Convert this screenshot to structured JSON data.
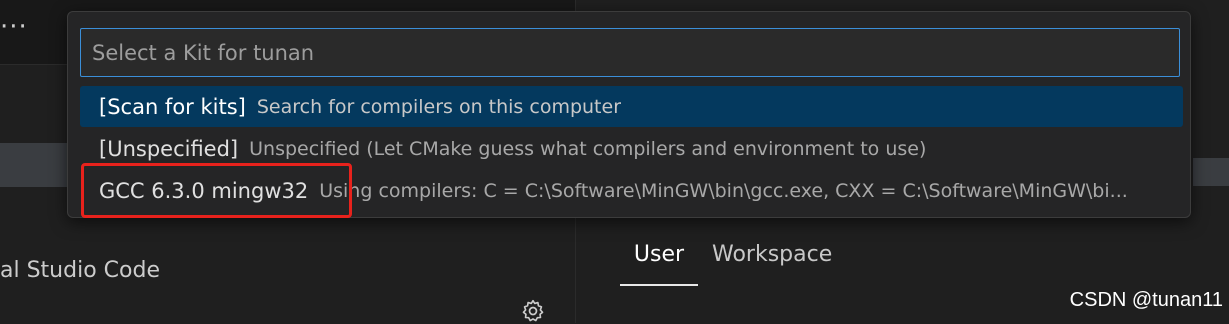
{
  "quick_pick": {
    "placeholder": "Select a Kit for tunan",
    "input_value": "",
    "items": [
      {
        "label": "[Scan for kits]",
        "description": "Search for compilers on this computer",
        "selected": true
      },
      {
        "label": "[Unspecified]",
        "description": "Unspecified (Let CMake guess what compilers and environment to use)",
        "selected": false
      },
      {
        "label": "GCC 6.3.0 mingw32",
        "description": "Using compilers: C = C:\\Software\\MinGW\\bin\\gcc.exe, CXX = C:\\Software\\MinGW\\bi...",
        "selected": false
      }
    ]
  },
  "background": {
    "more_actions": "···",
    "left_text": "al Studio Code",
    "settings_tabs": [
      {
        "label": "User",
        "active": true
      },
      {
        "label": "Workspace",
        "active": false
      }
    ],
    "gear_icon": "gear-icon"
  },
  "watermark": "CSDN @tunan11",
  "colors": {
    "selection": "#04395e",
    "focus_border": "#3b8fd9",
    "annotation": "#e8221c",
    "panel": "#252526",
    "editor_bg": "#1f1f1f"
  }
}
